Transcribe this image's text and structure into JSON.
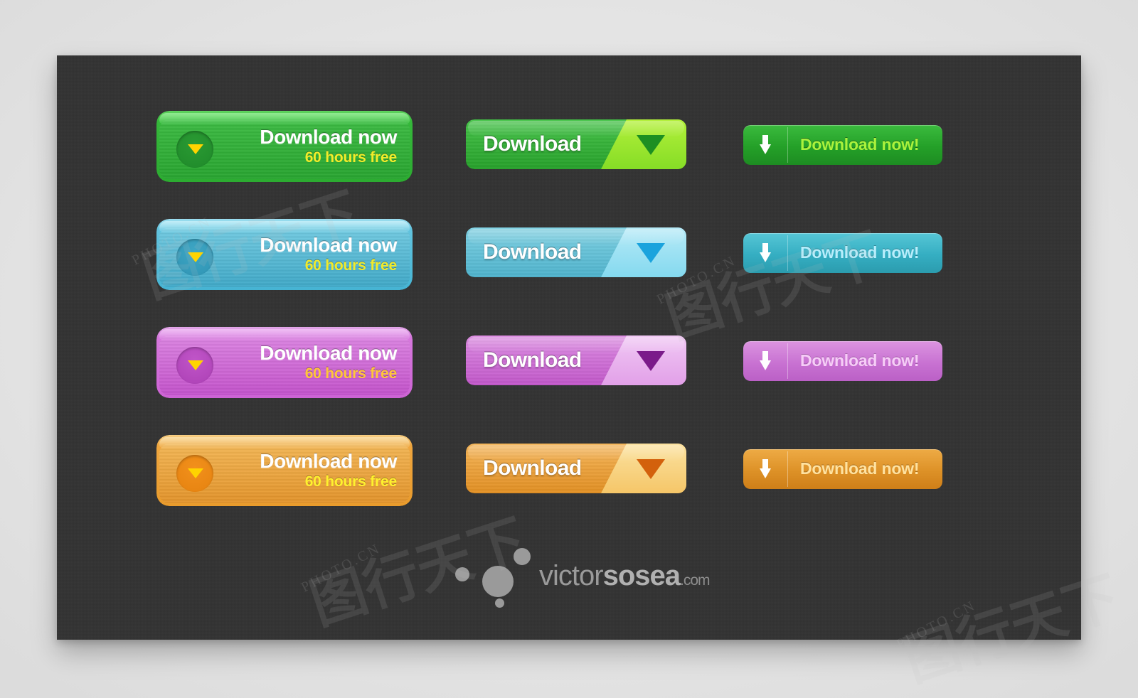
{
  "canvas": {
    "background_color": "#333333",
    "page_background_color": "#e9e9e9"
  },
  "buttons": {
    "style_a": {
      "title": "Download now",
      "subtitle": "60 hours free",
      "icon": "triangle-down-icon"
    },
    "style_b": {
      "label": "Download",
      "icon": "triangle-down-icon"
    },
    "style_c": {
      "label": "Download now!",
      "icon": "arrow-down-icon"
    }
  },
  "rows": [
    {
      "name": "green",
      "accent": "#2fb038",
      "style_a": {
        "title": "Download now",
        "subtitle": "60 hours free"
      },
      "style_b": {
        "label": "Download"
      },
      "style_c": {
        "label": "Download now!"
      }
    },
    {
      "name": "blue",
      "accent": "#56bcd6",
      "style_a": {
        "title": "Download now",
        "subtitle": "60 hours free"
      },
      "style_b": {
        "label": "Download"
      },
      "style_c": {
        "label": "Download now!"
      }
    },
    {
      "name": "purple",
      "accent": "#cf69d6",
      "style_a": {
        "title": "Download now",
        "subtitle": "60 hours free"
      },
      "style_b": {
        "label": "Download"
      },
      "style_c": {
        "label": "Download now!"
      }
    },
    {
      "name": "orange",
      "accent": "#eda43a",
      "style_a": {
        "title": "Download now",
        "subtitle": "60 hours free"
      },
      "style_b": {
        "label": "Download"
      },
      "style_c": {
        "label": "Download now!"
      }
    }
  ],
  "logo": {
    "part_light": "victor",
    "part_bold": "sosea",
    "tld": ".com"
  },
  "watermarks": {
    "cn_1": "PHOTO.CN",
    "cn_2": "PHOTO.CN",
    "cn_3": "PHOTO.CN",
    "cn_4": "PHOTO.CN",
    "cjk_1": "图行天下",
    "cjk_2": "图行天下",
    "cjk_3": "图行天下",
    "cjk_4": "图行天下"
  }
}
